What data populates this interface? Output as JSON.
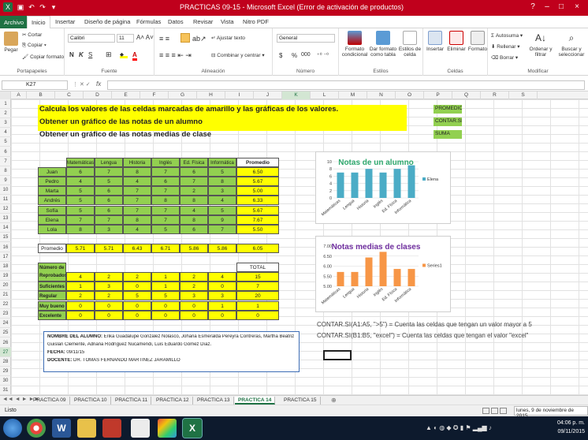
{
  "window": {
    "title": "PRACTICAS 09-15 - Microsoft Excel (Error de activación de productos)",
    "controls": [
      "?",
      "–",
      "□",
      "×"
    ]
  },
  "tabs": {
    "file": "Archivo",
    "items": [
      "Inicio",
      "Insertar",
      "Diseño de página",
      "Fórmulas",
      "Datos",
      "Revisar",
      "Vista",
      "Nitro PDF"
    ],
    "active": "Inicio"
  },
  "ribbon": {
    "clipboard": {
      "label": "Portapapeles",
      "paste": "Pegar",
      "cut": "Cortar",
      "copy": "Copiar",
      "format_painter": "Copiar formato"
    },
    "font": {
      "label": "Fuente",
      "name": "Calibri",
      "size": "11",
      "bold": "N",
      "italic": "K",
      "underline": "S"
    },
    "alignment": {
      "label": "Alineación",
      "wrap": "Ajustar texto",
      "merge": "Combinar y centrar"
    },
    "number": {
      "label": "Número",
      "format": "General",
      "currency": "$",
      "percent": "%",
      "thousands": "000"
    },
    "styles": {
      "label": "Estilos",
      "conditional": "Formato condicional",
      "as_table": "Dar formato como tabla",
      "cell_styles": "Estilos de celda"
    },
    "cells": {
      "label": "Celdas",
      "insert": "Insertar",
      "delete": "Eliminar",
      "format": "Formato"
    },
    "editing": {
      "label": "Modificar",
      "autosum": "Autosuma",
      "fill": "Rellenar",
      "clear": "Borrar",
      "sort": "Ordenar y filtrar",
      "find": "Buscar y seleccionar"
    }
  },
  "formula_bar": {
    "name_box": "K27",
    "fx": "fx",
    "value": ""
  },
  "columns": [
    "A",
    "B",
    "C",
    "D",
    "E",
    "F",
    "G",
    "H",
    "I",
    "J",
    "K",
    "L",
    "M",
    "N",
    "O",
    "P",
    "Q",
    "R",
    "S"
  ],
  "rows": [
    "1",
    "2",
    "3",
    "4",
    "5",
    "6",
    "7",
    "8",
    "9",
    "10",
    "11",
    "12",
    "13",
    "14",
    "15",
    "16",
    "17",
    "18",
    "19",
    "20",
    "21",
    "22",
    "23",
    "24",
    "25",
    "26",
    "27",
    "28",
    "29",
    "30",
    "31"
  ],
  "sheet": {
    "headings": [
      "Calcula los valores de las celdas marcadas de amarillo y las gráficas de los valores.",
      "Obtener un gráfico de las notas de un alumno",
      "Obtener un gráfico de las notas medias de clase"
    ],
    "side_labels": [
      "PROMEDIO",
      "CONTAR.SI",
      "SUMA"
    ],
    "subjects": [
      "Matemáticas",
      "Lengua",
      "Historia",
      "Inglés",
      "Ed. Física",
      "Informática"
    ],
    "promedio_header": "Promedio",
    "students": [
      {
        "name": "Juan",
        "grades": [
          "6",
          "7",
          "8",
          "7",
          "6",
          "5"
        ],
        "avg": "6.50"
      },
      {
        "name": "Pedro",
        "grades": [
          "4",
          "5",
          "4",
          "6",
          "7",
          "8"
        ],
        "avg": "5.67"
      },
      {
        "name": "Marta",
        "grades": [
          "5",
          "6",
          "7",
          "7",
          "2",
          "3"
        ],
        "avg": "5.00"
      },
      {
        "name": "Andrés",
        "grades": [
          "5",
          "6",
          "7",
          "8",
          "8",
          "4"
        ],
        "avg": "6.33"
      },
      {
        "name": "Sofía",
        "grades": [
          "5",
          "6",
          "7",
          "7",
          "4",
          "5"
        ],
        "avg": "5.67"
      },
      {
        "name": "Elena",
        "grades": [
          "7",
          "7",
          "8",
          "7",
          "8",
          "9"
        ],
        "avg": "7.67"
      },
      {
        "name": "Lola",
        "grades": [
          "8",
          "3",
          "4",
          "5",
          "6",
          "7"
        ],
        "avg": "5.50"
      }
    ],
    "promedio_row": {
      "label": "Promedio",
      "values": [
        "5.71",
        "5.71",
        "6.43",
        "6.71",
        "5.86",
        "5.86"
      ],
      "total": "6.05"
    },
    "counts": {
      "total_header": "TOTAL",
      "rows": [
        {
          "label": "Número de Reprobados",
          "values": [
            "4",
            "2",
            "2",
            "1",
            "2",
            "4"
          ],
          "total": "15"
        },
        {
          "label": "Suficientes",
          "values": [
            "1",
            "3",
            "0",
            "1",
            "2",
            "0"
          ],
          "total": "7"
        },
        {
          "label": "Regular",
          "values": [
            "2",
            "2",
            "5",
            "5",
            "3",
            "3"
          ],
          "total": "20"
        },
        {
          "label": "Muy bueno",
          "values": [
            "0",
            "0",
            "0",
            "0",
            "0",
            "1"
          ],
          "total": "1"
        },
        {
          "label": "Excelente",
          "values": [
            "0",
            "0",
            "0",
            "0",
            "0",
            "0"
          ],
          "total": "0"
        }
      ]
    },
    "notes": [
      "CONTAR.SI(A1:A5, \">5\") = Cuenta las celdas que tengan un valor mayor a 5",
      "CONTAR.SI(B1:B5, \"excel\") = Cuenta las celdas que tengan el valor \"excel\""
    ],
    "info_box": {
      "l1a": "NOMBRE DEL ALUMNO:",
      "l1b": " Erika Guadalupe González Nolasco, Johana Esmeralda Pereyra Contreras, Martha Beatriz",
      "l2": "Guislan Clemente, Adriana Rodríguez Nucamendi, Luis Eduardo Gómez Díaz.",
      "l3a": "FECHA:",
      "l3b": " 09/11/15",
      "l4a": "DOCENTE:",
      "l4b": " DR. TOMAS FERNANDO MARTINEZ JARAMILLO"
    }
  },
  "chart_data": [
    {
      "type": "bar",
      "title": "Notas de un alumno",
      "categories": [
        "Matemáticas",
        "Lengua",
        "Historia",
        "Inglés",
        "Ed. Física",
        "Informática"
      ],
      "series": [
        {
          "name": "Elena",
          "values": [
            7,
            7,
            8,
            7,
            8,
            9
          ]
        }
      ],
      "ylim": [
        0,
        10
      ],
      "yticks": [
        "0",
        "2",
        "4",
        "6",
        "8",
        "10"
      ],
      "color": "#4bacc6",
      "title_color": "#2ea86d",
      "legend": "right"
    },
    {
      "type": "bar",
      "title": "Notas medias de clases",
      "categories": [
        "Matemáticas",
        "Lengua",
        "Historia",
        "Inglés",
        "Ed. Física",
        "Informática"
      ],
      "series": [
        {
          "name": "Series1",
          "values": [
            5.71,
            5.71,
            6.43,
            6.71,
            5.86,
            5.86
          ]
        }
      ],
      "ylim": [
        5,
        7
      ],
      "yticks": [
        "5.00",
        "5.50",
        "6.00",
        "6.50",
        "7.00"
      ],
      "color": "#f79646",
      "title_color": "#7030a0",
      "legend": "right"
    }
  ],
  "sheet_tabs": {
    "items": [
      "PRACTICA 09",
      "PRACTICA 10",
      "PRACTICA 11",
      "PRACTICA 12",
      "PRACTICA 13",
      "PRACTICA 14",
      "PRACTICA 15"
    ],
    "active": "PRACTICA 14"
  },
  "status": {
    "left": "Listo",
    "date_panel": "lunes, 9 de noviembre de 2015"
  },
  "taskbar": {
    "time": "04:06 p. m.",
    "date": "09/11/2015"
  },
  "colors": {
    "excel_green": "#1f7244",
    "title_red": "#c0001c",
    "yellow": "#ffff00",
    "green_cell": "#92d050"
  }
}
